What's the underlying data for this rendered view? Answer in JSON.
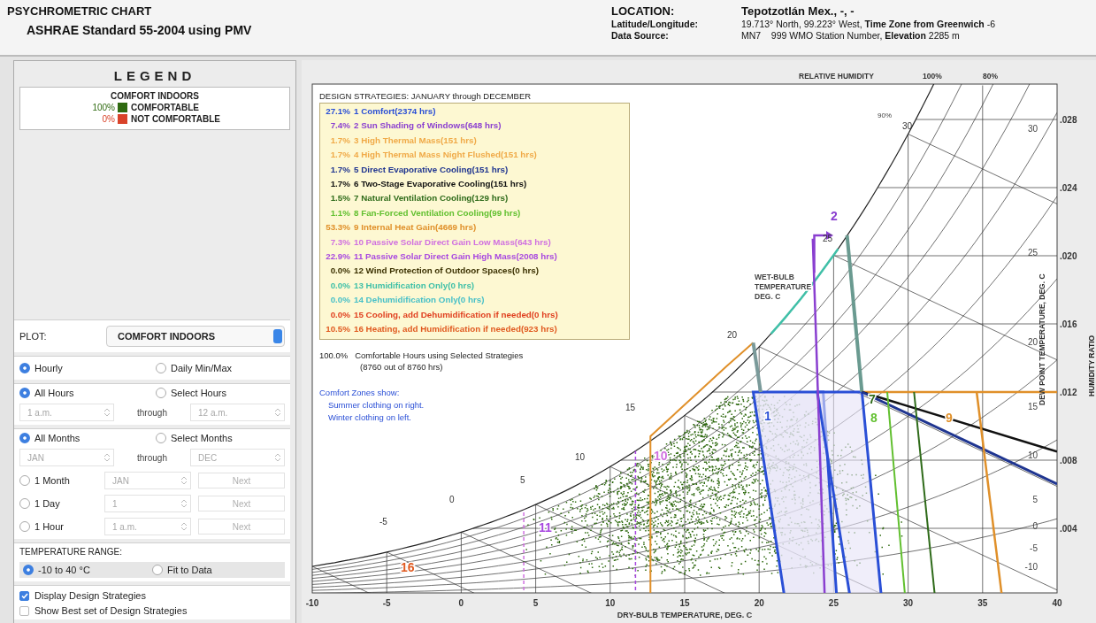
{
  "header": {
    "title": "PSYCHROMETRIC CHART",
    "subtitle": "ASHRAE Standard 55-2004 using PMV",
    "location": {
      "label": "LOCATION:",
      "value": "Tepotzotlán Mex., -, -"
    },
    "lat_long": {
      "label": "Latitude/Longitude:",
      "value": "19.713° North, 99.223° West, **Time Zone from Greenwich** -6"
    },
    "data_source": {
      "label": "Data Source:",
      "value": "MN7    999 WMO Station Number, **Elevation** 2285 m"
    }
  },
  "legend": {
    "title": "LEGEND",
    "box_title": "COMFORT INDOORS",
    "items": [
      {
        "percent": "100%",
        "label": "COMFORTABLE",
        "color": "#2f6a10"
      },
      {
        "percent": "0%",
        "label": "NOT COMFORTABLE",
        "color": "#d9432a"
      }
    ]
  },
  "controls": {
    "plot": {
      "label": "PLOT:",
      "value": "COMFORT INDOORS"
    },
    "data_mode": [
      {
        "label": "Hourly",
        "selected": true
      },
      {
        "label": "Daily Min/Max",
        "selected": false
      }
    ],
    "hours": {
      "options": [
        {
          "label": "All Hours",
          "selected": true
        },
        {
          "label": "Select Hours",
          "selected": false
        }
      ],
      "from": "1 a.m.",
      "through": "through",
      "to": "12 a.m.",
      "disabled": true
    },
    "months": {
      "options": [
        {
          "label": "All Months",
          "selected": true
        },
        {
          "label": "Select Months",
          "selected": false
        }
      ],
      "from": "JAN",
      "through": "through",
      "to": "DEC",
      "disabled": true
    },
    "single": [
      {
        "label": "1 Month",
        "selected": false,
        "value": "JAN",
        "next": "Next",
        "disabled": true
      },
      {
        "label": "1 Day",
        "selected": false,
        "value": "1",
        "next": "Next",
        "disabled": true
      },
      {
        "label": "1 Hour",
        "selected": false,
        "value": "1 a.m.",
        "next": "Next",
        "disabled": true
      }
    ],
    "temperature_range": {
      "label": "TEMPERATURE RANGE:",
      "options": [
        {
          "label": "-10 to 40 °C",
          "selected": true
        },
        {
          "label": "Fit to Data",
          "selected": false
        }
      ]
    },
    "checkboxes": [
      {
        "label": "Display Design Strategies",
        "checked": true
      },
      {
        "label": "Show Best set of Design Strategies",
        "checked": false
      }
    ]
  },
  "chart": {
    "strategies": {
      "title": "DESIGN STRATEGIES:  JANUARY through DECEMBER",
      "items": [
        {
          "percent": "27.1%",
          "label": "1 Comfort(2374 hrs)",
          "color": "#2a4fd6"
        },
        {
          "percent": "7.4%",
          "label": "2 Sun Shading of Windows(648 hrs)",
          "color": "#8a3fd0"
        },
        {
          "percent": "1.7%",
          "label": "3 High Thermal Mass(151 hrs)",
          "color": "#f0aa48"
        },
        {
          "percent": "1.7%",
          "label": "4 High Thermal Mass Night Flushed(151 hrs)",
          "color": "#f0aa48"
        },
        {
          "percent": "1.7%",
          "label": "5 Direct Evaporative Cooling(151 hrs)",
          "color": "#1f3590"
        },
        {
          "percent": "1.7%",
          "label": "6 Two-Stage Evaporative Cooling(151 hrs)",
          "color": "#111111"
        },
        {
          "percent": "1.5%",
          "label": "7 Natural Ventilation Cooling(129 hrs)",
          "color": "#2f6b1a"
        },
        {
          "percent": "1.1%",
          "label": "8 Fan-Forced Ventilation Cooling(99 hrs)",
          "color": "#62c030"
        },
        {
          "percent": "53.3%",
          "label": "9 Internal Heat Gain(4669 hrs)",
          "color": "#e0902a"
        },
        {
          "percent": "7.3%",
          "label": "10 Passive Solar Direct Gain Low Mass(643 hrs)",
          "color": "#d070e0"
        },
        {
          "percent": "22.9%",
          "label": "11 Passive Solar Direct Gain High Mass(2008 hrs)",
          "color": "#a848e0"
        },
        {
          "percent": "0.0%",
          "label": "12 Wind Protection of Outdoor Spaces(0 hrs)",
          "color": "#3a3000"
        },
        {
          "percent": "0.0%",
          "label": "13 Humidification Only(0 hrs)",
          "color": "#40c0a8"
        },
        {
          "percent": "0.0%",
          "label": "14 Dehumidification Only(0 hrs)",
          "color": "#48c0c8"
        },
        {
          "percent": "0.0%",
          "label": "15 Cooling, add Dehumidification if needed(0 hrs)",
          "color": "#e04020"
        },
        {
          "percent": "10.5%",
          "label": "16 Heating, add Humidification if needed(923 hrs)",
          "color": "#e05a20"
        }
      ]
    },
    "summary": {
      "percent": "100.0%",
      "text": "Comfortable Hours using Selected Strategies",
      "hours": "(8760 out of 8760 hrs)"
    },
    "comfort_note": {
      "title": "Comfort Zones show:",
      "lines": [
        "Summer clothing on right.",
        "Winter clothing on left."
      ]
    },
    "relative_humidity": {
      "label": "RELATIVE HUMIDITY",
      "values": [
        "100%",
        "80%"
      ],
      "inner": "90%"
    },
    "wet_bulb_label": [
      "WET-BULB",
      "TEMPERATURE",
      "DEG. C"
    ],
    "wet_bulb_ticks": [
      "-5",
      "0",
      "5",
      "10",
      "15",
      "20",
      "25",
      "30"
    ],
    "dew_point_label": "DEW POINT TEMPERATURE, DEG. C",
    "dew_point_ticks": [
      "30",
      "25",
      "20",
      "15",
      "10",
      "5",
      "0",
      "-5",
      "-10"
    ],
    "humidity_ratio_label": "HUMIDITY RATIO",
    "humidity_ratio_ticks": [
      ".028",
      ".024",
      ".020",
      ".016",
      ".012",
      ".008",
      ".004"
    ],
    "x_label": "DRY-BULB TEMPERATURE, DEG. C",
    "x_ticks": [
      "-10",
      "-5",
      "0",
      "5",
      "10",
      "15",
      "20",
      "25",
      "30",
      "35",
      "40"
    ],
    "zone_labels": [
      {
        "text": "1"
      },
      {
        "text": "2"
      },
      {
        "text": "7"
      },
      {
        "text": "8"
      },
      {
        "text": "9"
      },
      {
        "text": "10"
      },
      {
        "text": "11"
      },
      {
        "text": "16"
      }
    ]
  }
}
